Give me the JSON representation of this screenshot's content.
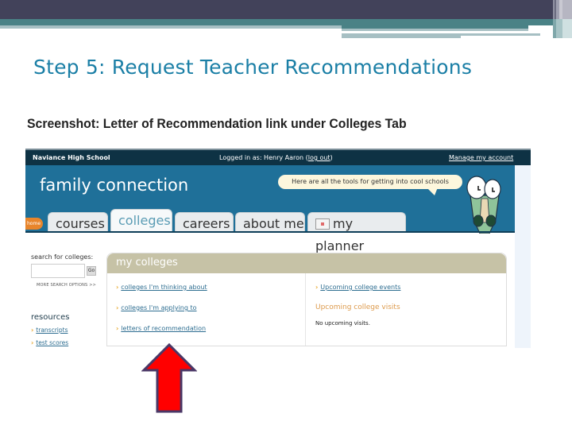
{
  "slide": {
    "title": "Step 5: Request Teacher Recommendations",
    "caption": "Screenshot: Letter of Recommendation link under Colleges Tab",
    "colors": {
      "title": "#1b7fa6",
      "arrow": "#ff0000",
      "arrow_outline": "#4a3766"
    }
  },
  "screenshot": {
    "topbar": {
      "school": "Naviance High School",
      "logged_prefix": "Logged in as: Henry Aaron (",
      "logout": "log out",
      "logged_suffix": ")",
      "manage_account": "Manage my account"
    },
    "banner": {
      "title": "family connection",
      "bubble": "Here are all the tools for getting into cool schools",
      "mascot": "crocodile-mascot"
    },
    "tabs": [
      {
        "label": "home",
        "active": false
      },
      {
        "label": "courses",
        "active": false
      },
      {
        "label": "colleges",
        "active": true
      },
      {
        "label": "careers",
        "active": false
      },
      {
        "label": "about me",
        "active": false
      },
      {
        "label": "my planner",
        "active": false,
        "icon": "planner-icon"
      }
    ],
    "sidebar": {
      "search_label": "search for colleges:",
      "search_value": "",
      "go_label": "Go",
      "more_search": "MORE SEARCH OPTIONS >>",
      "resources_title": "resources",
      "resources": [
        "transcripts",
        "test scores"
      ]
    },
    "my_colleges": {
      "title": "my colleges",
      "links": [
        "colleges I'm thinking about",
        "colleges I'm applying to",
        "letters of recommendation"
      ],
      "events_link": "Upcoming college events",
      "visits_heading": "Upcoming college visits",
      "visits_text": "No upcoming visits."
    }
  }
}
